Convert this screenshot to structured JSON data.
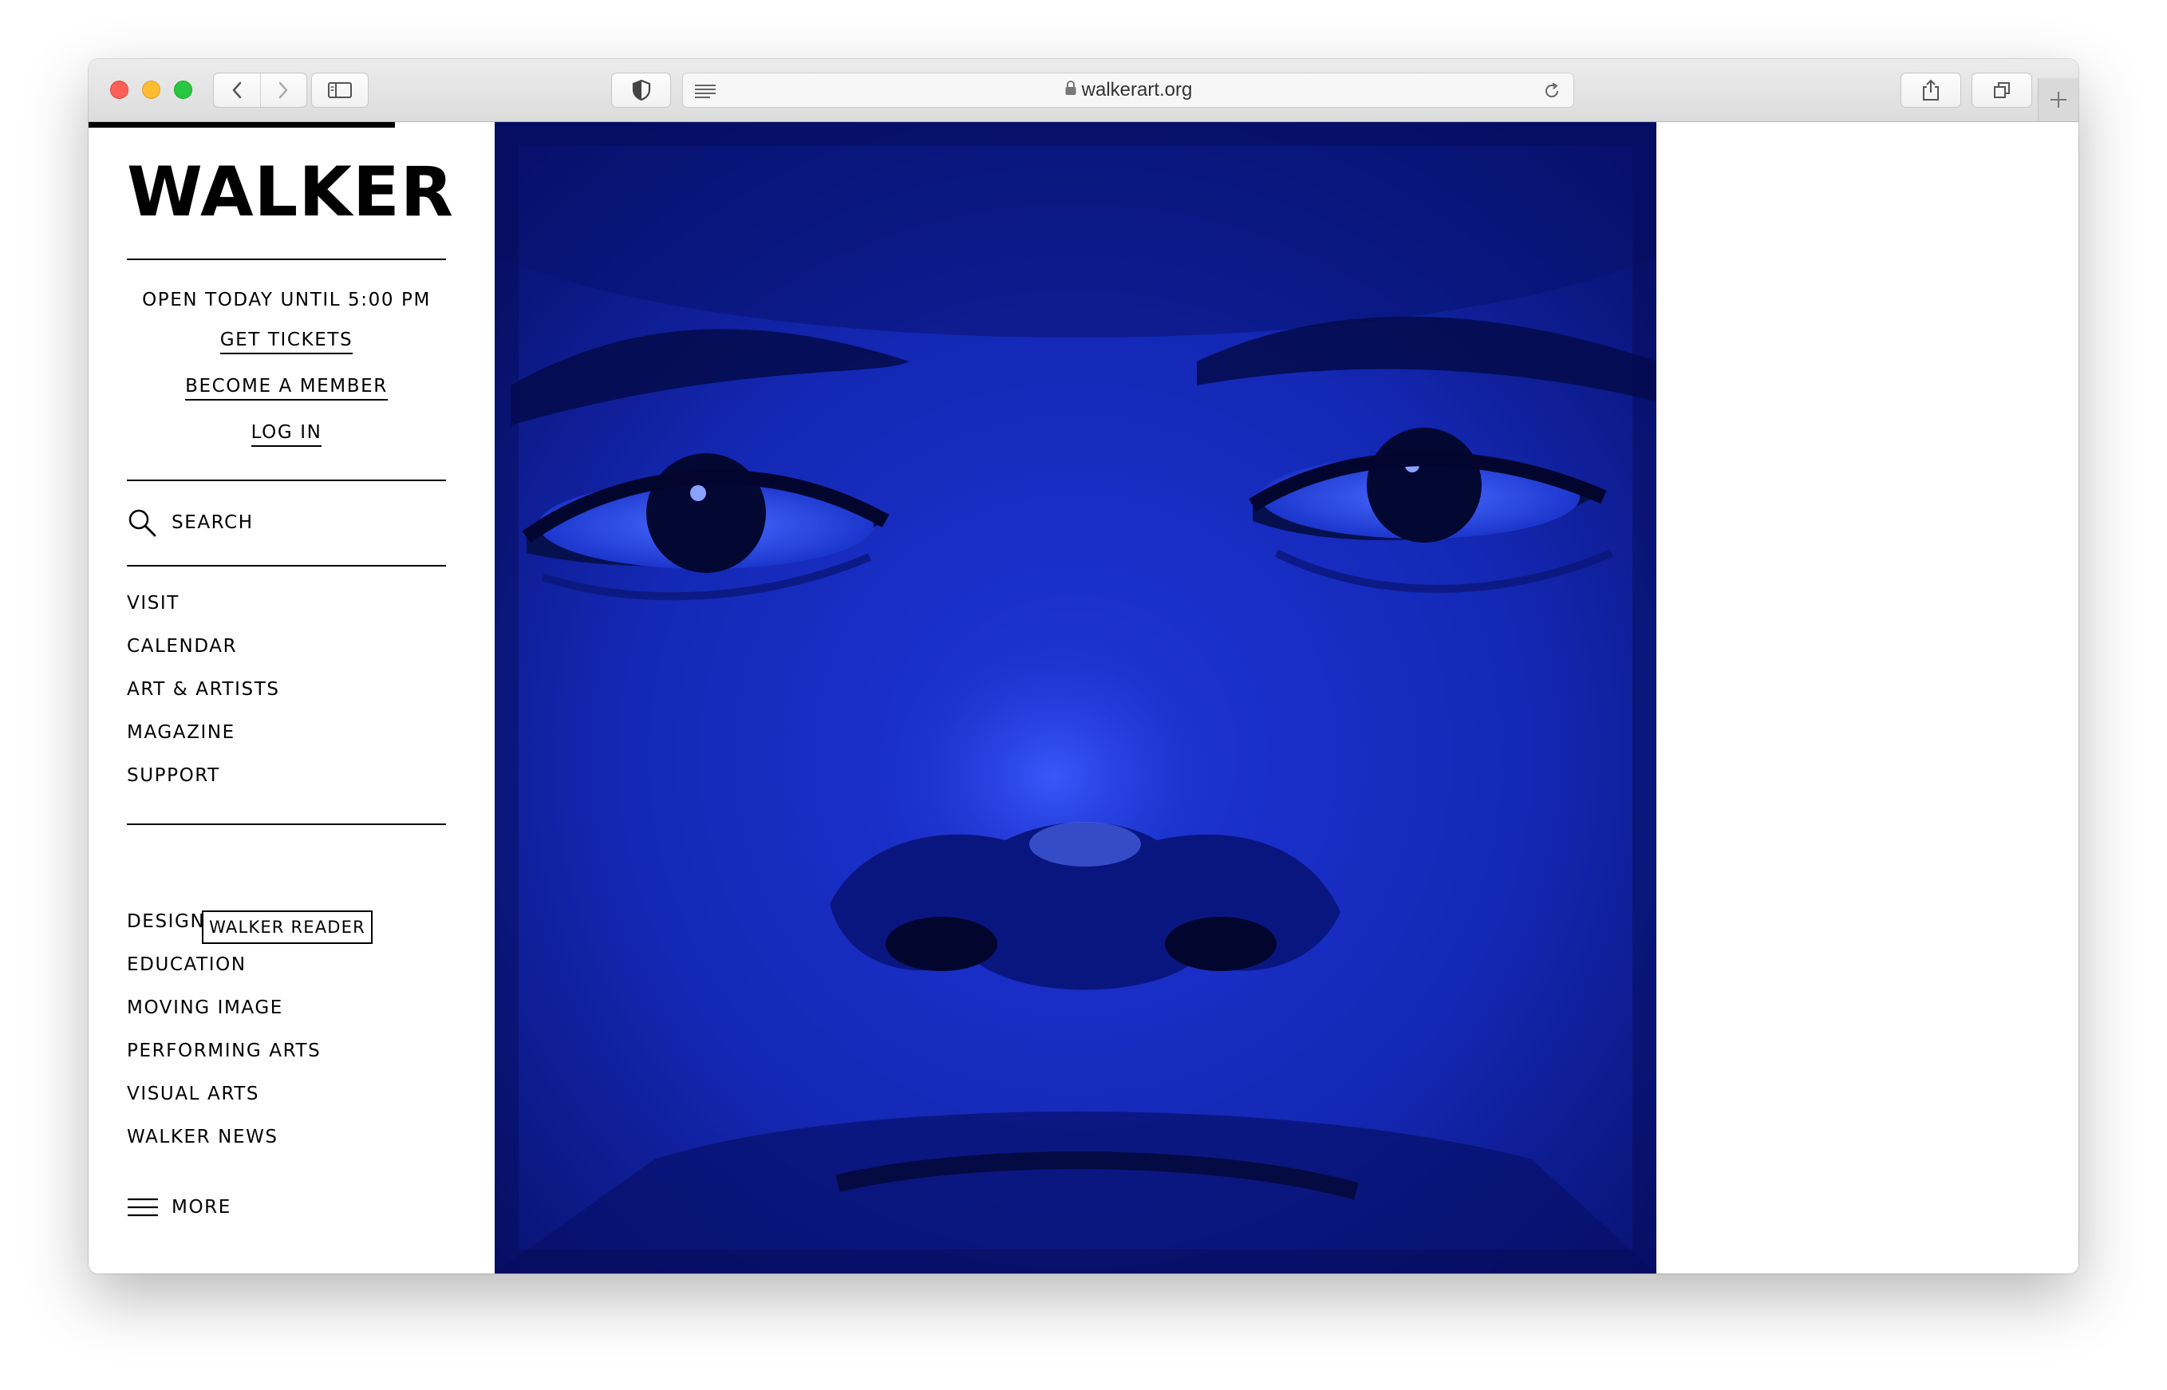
{
  "browser": {
    "url": "walkerart.org"
  },
  "site": {
    "logo": "WALKER",
    "hours": "OPEN TODAY UNTIL 5:00 PM",
    "get_tickets": "GET TICKETS",
    "become_member": "BECOME A MEMBER",
    "log_in": "LOG IN",
    "search_label": "SEARCH",
    "primary_nav": [
      "VISIT",
      "CALENDAR",
      "ART & ARTISTS",
      "MAGAZINE",
      "SUPPORT"
    ],
    "reader_label": "WALKER READER",
    "reader_nav": [
      "DESIGN",
      "EDUCATION",
      "MOVING IMAGE",
      "PERFORMING ARTS",
      "VISUAL ARTS",
      "WALKER NEWS"
    ],
    "more_label": "MORE"
  },
  "colors": {
    "hero_blue": "#0c1a9a",
    "text": "#000000"
  }
}
